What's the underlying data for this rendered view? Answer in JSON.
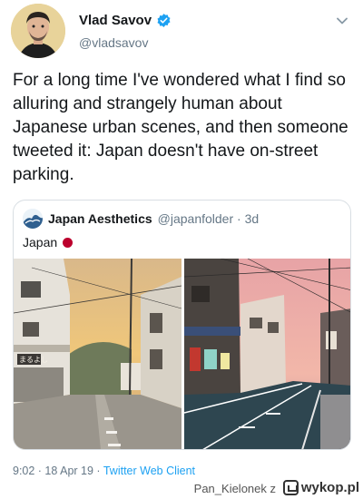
{
  "tweet": {
    "author_name": "Vlad Savov",
    "author_handle": "@vladsavov",
    "text": "For a long time I've wondered what I find so alluring and strangely human about Japanese urban scenes, and then someone tweeted it: Japan doesn't have on-street parking.",
    "timestamp": "9:02 · 18 Apr 19 · ",
    "client": "Twitter Web Client"
  },
  "quote": {
    "author_name": "Japan Aesthetics",
    "author_handle": "@japanfolder · 3d",
    "text": "Japan"
  },
  "footer": {
    "user": "Pan_Kielonek z",
    "site": "wykop.pl"
  },
  "icons": {
    "verified": "verified-badge-icon",
    "menu": "chevron-down-icon",
    "flag": "japan-flag-icon",
    "site_logo": "wykop-logo-icon"
  },
  "colors": {
    "link": "#1da1f2",
    "secondary_text": "#657786",
    "flag_red": "#bc002d"
  }
}
